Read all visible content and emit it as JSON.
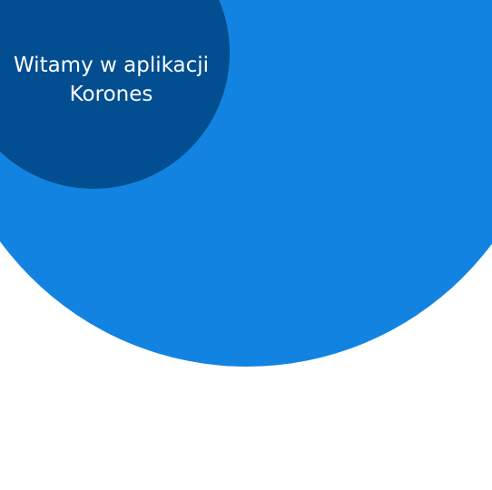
{
  "welcome": {
    "line1": "Witamy w aplikacji",
    "line2": "Korones"
  },
  "colors": {
    "background": "#ffffff",
    "primary_blue": "#1283e0",
    "dark_blue": "#034e90",
    "text": "#ffffff"
  }
}
